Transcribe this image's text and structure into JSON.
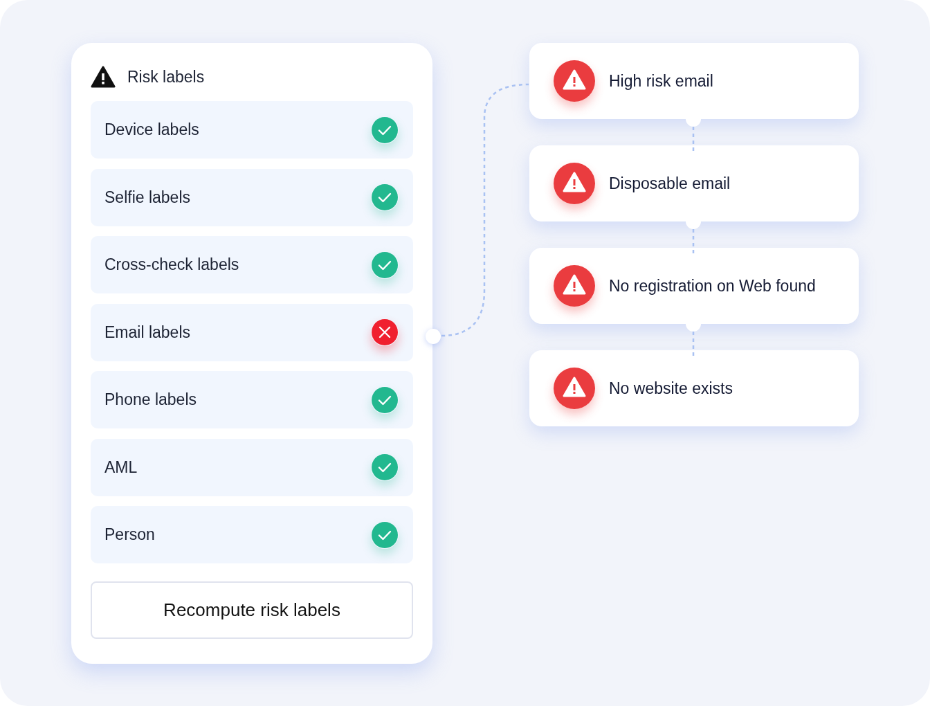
{
  "panel": {
    "title": "Risk labels",
    "labels": [
      {
        "label": "Device labels",
        "passed": true
      },
      {
        "label": "Selfie labels",
        "passed": true
      },
      {
        "label": "Cross-check labels",
        "passed": true
      },
      {
        "label": "Email labels",
        "passed": false
      },
      {
        "label": "Phone labels",
        "passed": true
      },
      {
        "label": "AML",
        "passed": true
      },
      {
        "label": "Person",
        "passed": true
      }
    ],
    "button": "Recompute risk labels"
  },
  "alerts": [
    {
      "label": "High risk email"
    },
    {
      "label": "Disposable email"
    },
    {
      "label": "No registration on Web found"
    },
    {
      "label": "No website exists"
    }
  ]
}
